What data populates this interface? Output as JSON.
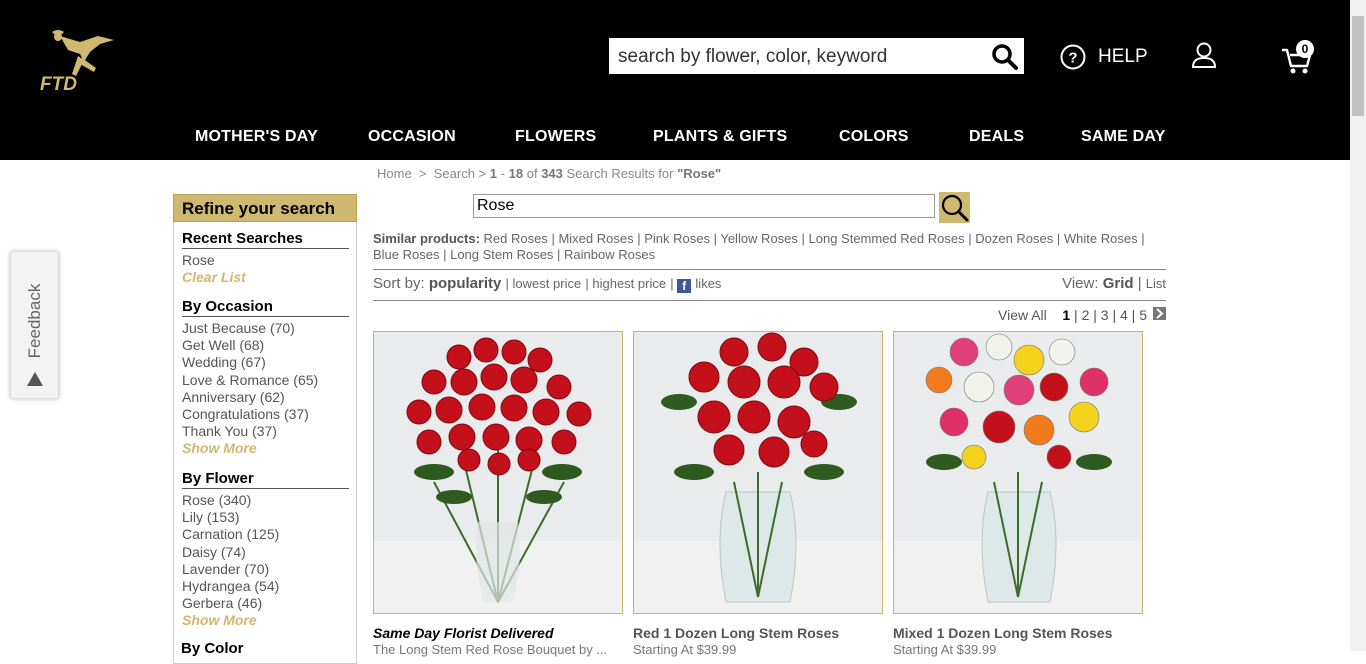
{
  "header": {
    "logo_text": "FTD",
    "search_placeholder": "search by flower, color, keyword",
    "help_label": "HELP",
    "cart_count": "0"
  },
  "nav": [
    "MOTHER'S DAY",
    "OCCASION",
    "FLOWERS",
    "PLANTS & GIFTS",
    "COLORS",
    "DEALS",
    "SAME DAY"
  ],
  "feedback_label": "Feedback",
  "breadcrumb": {
    "home": "Home",
    "sep1": ">",
    "search": "Search",
    "sep2": ">",
    "range_start": "1",
    "range_dash": "-",
    "range_end": "18",
    "of": "of",
    "total": "343",
    "suffix": "Search Results for",
    "query": "\"Rose\""
  },
  "sidebar": {
    "title": "Refine your search",
    "recent": {
      "title": "Recent Searches",
      "items": [
        "Rose"
      ],
      "clear_label": "Clear List"
    },
    "occasion": {
      "title": "By Occasion",
      "items": [
        "Just Because (70)",
        "Get Well (68)",
        "Wedding (67)",
        "Love & Romance (65)",
        "Anniversary (62)",
        "Congratulations (37)",
        "Thank You (37)"
      ],
      "more_label": "Show More"
    },
    "flower": {
      "title": "By Flower",
      "items": [
        "Rose (340)",
        "Lily (153)",
        "Carnation (125)",
        "Daisy (74)",
        "Lavender (70)",
        "Hydrangea (54)",
        "Gerbera (46)"
      ],
      "more_label": "Show More"
    },
    "color_title": "By Color"
  },
  "results_search_value": "Rose",
  "similar": {
    "label": "Similar products:",
    "items": [
      "Red Roses",
      "Mixed Roses",
      "Pink Roses",
      "Yellow Roses",
      "Long Stemmed Red Roses",
      "Dozen Roses",
      "White Roses",
      "Blue Roses",
      "Long Stem Roses",
      "Rainbow Roses"
    ]
  },
  "sort": {
    "label": "Sort by:",
    "popularity": "popularity",
    "lowest": "lowest price",
    "highest": "highest price",
    "likes": "likes",
    "view_label": "View:",
    "grid": "Grid",
    "list": "List"
  },
  "pager": {
    "view_all": "View All",
    "pages": [
      "1",
      "2",
      "3",
      "4",
      "5"
    ],
    "current": "1"
  },
  "products": [
    {
      "title": "Same Day Florist Delivered",
      "subtitle": "The Long Stem Red Rose Bouquet by ..."
    },
    {
      "title": "Red 1 Dozen Long Stem Roses",
      "subtitle": "Starting At $39.99"
    },
    {
      "title": "Mixed 1 Dozen Long Stem Roses",
      "subtitle": "Starting At $39.99"
    }
  ],
  "colors": {
    "accent_gold": "#cfb86f",
    "header_bg": "#000000",
    "rose_red": "#c4101a"
  }
}
